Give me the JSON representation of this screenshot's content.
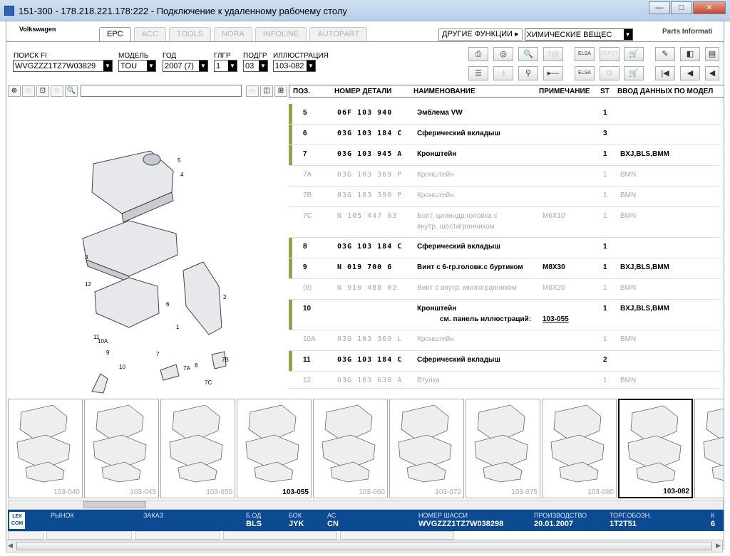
{
  "window": {
    "title": "151-300 - 178.218.221.178:222 - Подключение к удаленному рабочему столу"
  },
  "app": {
    "brand": "Volkswagen",
    "parts_info": "Parts Informati"
  },
  "tabs": [
    {
      "label": "EPC",
      "active": true
    },
    {
      "label": "ACC"
    },
    {
      "label": "TOOLS"
    },
    {
      "label": "NORA"
    },
    {
      "label": "INFOLINE"
    },
    {
      "label": "AUTOPART"
    }
  ],
  "other_functions": {
    "label": "ДРУГИЕ ФУНКЦИИ ▸",
    "value": "ХИМИЧЕСКИЕ ВЕЩЕС"
  },
  "filters": {
    "search_fi": {
      "label": "ПОИСК FI",
      "value": "WVGZZZ1TZ7W03829"
    },
    "model": {
      "label": "МОДЕЛЬ",
      "value": "TOU"
    },
    "year": {
      "label": "ГОД",
      "value": "2007 (7)"
    },
    "glgr": {
      "label": "ГЛГР",
      "value": "1"
    },
    "podgr": {
      "label": "ПОДГР",
      "value": "03"
    },
    "illustration": {
      "label": "ИЛЛЮСТРАЦИЯ",
      "value": "103-082"
    }
  },
  "toolbar_icons": [
    "print-icon",
    "cd-icon",
    "car-search-icon",
    "help-icon",
    "elsa-icon",
    "depot-icon",
    "cart-add-icon",
    "pin-icon",
    "page-back-icon",
    "list-icon",
    "key-icon",
    "scooter-icon",
    "play-minus-icon",
    "elsa2-icon",
    "depot2-icon",
    "cart-icon",
    "first-icon",
    "prev-icon",
    "back-icon"
  ],
  "toolbar_labels": {
    "elsa": "ELSA",
    "depot": "DEPOT",
    "help": "?@"
  },
  "table": {
    "headers": [
      "ПОЗ.",
      "НОМЕР ДЕТАЛИ",
      "НАИМЕНОВАНИЕ",
      "ПРИМЕЧАНИЕ",
      "ST",
      "ВВОД ДАННЫХ ПО МОДЕЛ"
    ],
    "rows": [
      {
        "pos": "5",
        "part": "06F 103 940",
        "name": "Эмблема VW",
        "note": "",
        "st": "1",
        "model": "",
        "style": "b",
        "bar": true
      },
      {
        "pos": "6",
        "part": "03G 103 184 C",
        "name": "Сферический вкладыш",
        "note": "",
        "st": "3",
        "model": "",
        "style": "b",
        "bar": true
      },
      {
        "pos": "7",
        "part": "03G 103 945 A",
        "name": "Кронштейн",
        "note": "",
        "st": "1",
        "model": "BXJ,BLS,BMM",
        "style": "b",
        "bar": true
      },
      {
        "pos": "7A",
        "part": "03G 103 369 P",
        "name": "Кронштейн",
        "note": "",
        "st": "1",
        "model": "BMN",
        "style": "g",
        "bar": false
      },
      {
        "pos": "7B",
        "part": "03G 103 390 P",
        "name": "Кронштейн",
        "note": "",
        "st": "1",
        "model": "BMN",
        "style": "g",
        "bar": false
      },
      {
        "pos": "7C",
        "part": "N   105 447 03",
        "name": "Болт, цилиндр.головка с",
        "name2": "внутр. шестигранником",
        "note": "M6X10",
        "st": "1",
        "model": "BMN",
        "style": "g",
        "bar": false
      },
      {
        "pos": "8",
        "part": "03G 103 184 C",
        "name": "Сферический вкладыш",
        "note": "",
        "st": "1",
        "model": "",
        "style": "b",
        "bar": true
      },
      {
        "pos": "9",
        "part": "N   019 700 6",
        "name": "Винт с 6-гр.головк.с буртиком",
        "note": "M8X30",
        "st": "1",
        "model": "BXJ,BLS,BMM",
        "style": "b",
        "bar": true
      },
      {
        "pos": "(9)",
        "part": "N   910 488 02",
        "name": "Винт с внутр. многогранником",
        "note": "M8X20",
        "st": "1",
        "model": "BMN",
        "style": "g",
        "bar": false
      },
      {
        "pos": "10",
        "part": "",
        "name": "Кронштейн",
        "name2_prefix": "см. панель иллюстраций:",
        "name2_link": "103-055",
        "note": "",
        "st": "1",
        "model": "BXJ,BLS,BMM",
        "style": "b",
        "bar": true
      },
      {
        "pos": "10A",
        "part": "03G 103 369 L",
        "name": "Кронштейн",
        "note": "",
        "st": "1",
        "model": "BMN",
        "style": "g",
        "bar": false
      },
      {
        "pos": "11",
        "part": "03G 103 184 C",
        "name": "Сферический вкладыш",
        "note": "",
        "st": "2",
        "model": "",
        "style": "b",
        "bar": true
      },
      {
        "pos": "12",
        "part": "03G 103 638 A",
        "name": "Втулка",
        "note": "",
        "st": "1",
        "model": "BMN",
        "style": "g",
        "bar": false
      }
    ]
  },
  "diagram_callouts": [
    "4",
    "5",
    "3",
    "12",
    "6",
    "2",
    "1",
    "11",
    "10A",
    "10",
    "9",
    "7",
    "7A",
    "8",
    "7B",
    "7C"
  ],
  "thumbnails": [
    {
      "label": "103-040",
      "bold": false,
      "sel": false
    },
    {
      "label": "103-045",
      "bold": false,
      "sel": false
    },
    {
      "label": "103-050",
      "bold": false,
      "sel": false
    },
    {
      "label": "103-055",
      "bold": true,
      "sel": false
    },
    {
      "label": "103-060",
      "bold": false,
      "sel": false
    },
    {
      "label": "103-072",
      "bold": false,
      "sel": false
    },
    {
      "label": "103-075",
      "bold": false,
      "sel": false
    },
    {
      "label": "103-080",
      "bold": false,
      "sel": false
    },
    {
      "label": "103-082",
      "bold": true,
      "sel": true
    },
    {
      "label": "",
      "bold": false,
      "sel": false
    }
  ],
  "status": {
    "logo": "LEX COM",
    "market_label": "РЫНОК",
    "market_value": "",
    "order_label": "ЗАКАЗ",
    "order_value": "",
    "bod_label": "Б.ОД",
    "bod_value": "BLS",
    "bok_label": "БОК",
    "bok_value": "JYK",
    "ac_label": "АС",
    "ac_value": "CN",
    "chassis_label": "НОМЕР ШАССИ",
    "chassis_value": "WVGZZZ1TZ7W038298",
    "prod_label": "ПРОИЗВОДСТВО",
    "prod_value": "20.01.2007",
    "torg_label": "ТОРГ.ОБОЗН.",
    "torg_value": "1T2T51",
    "cut_label": "К",
    "cut_value": "6"
  }
}
